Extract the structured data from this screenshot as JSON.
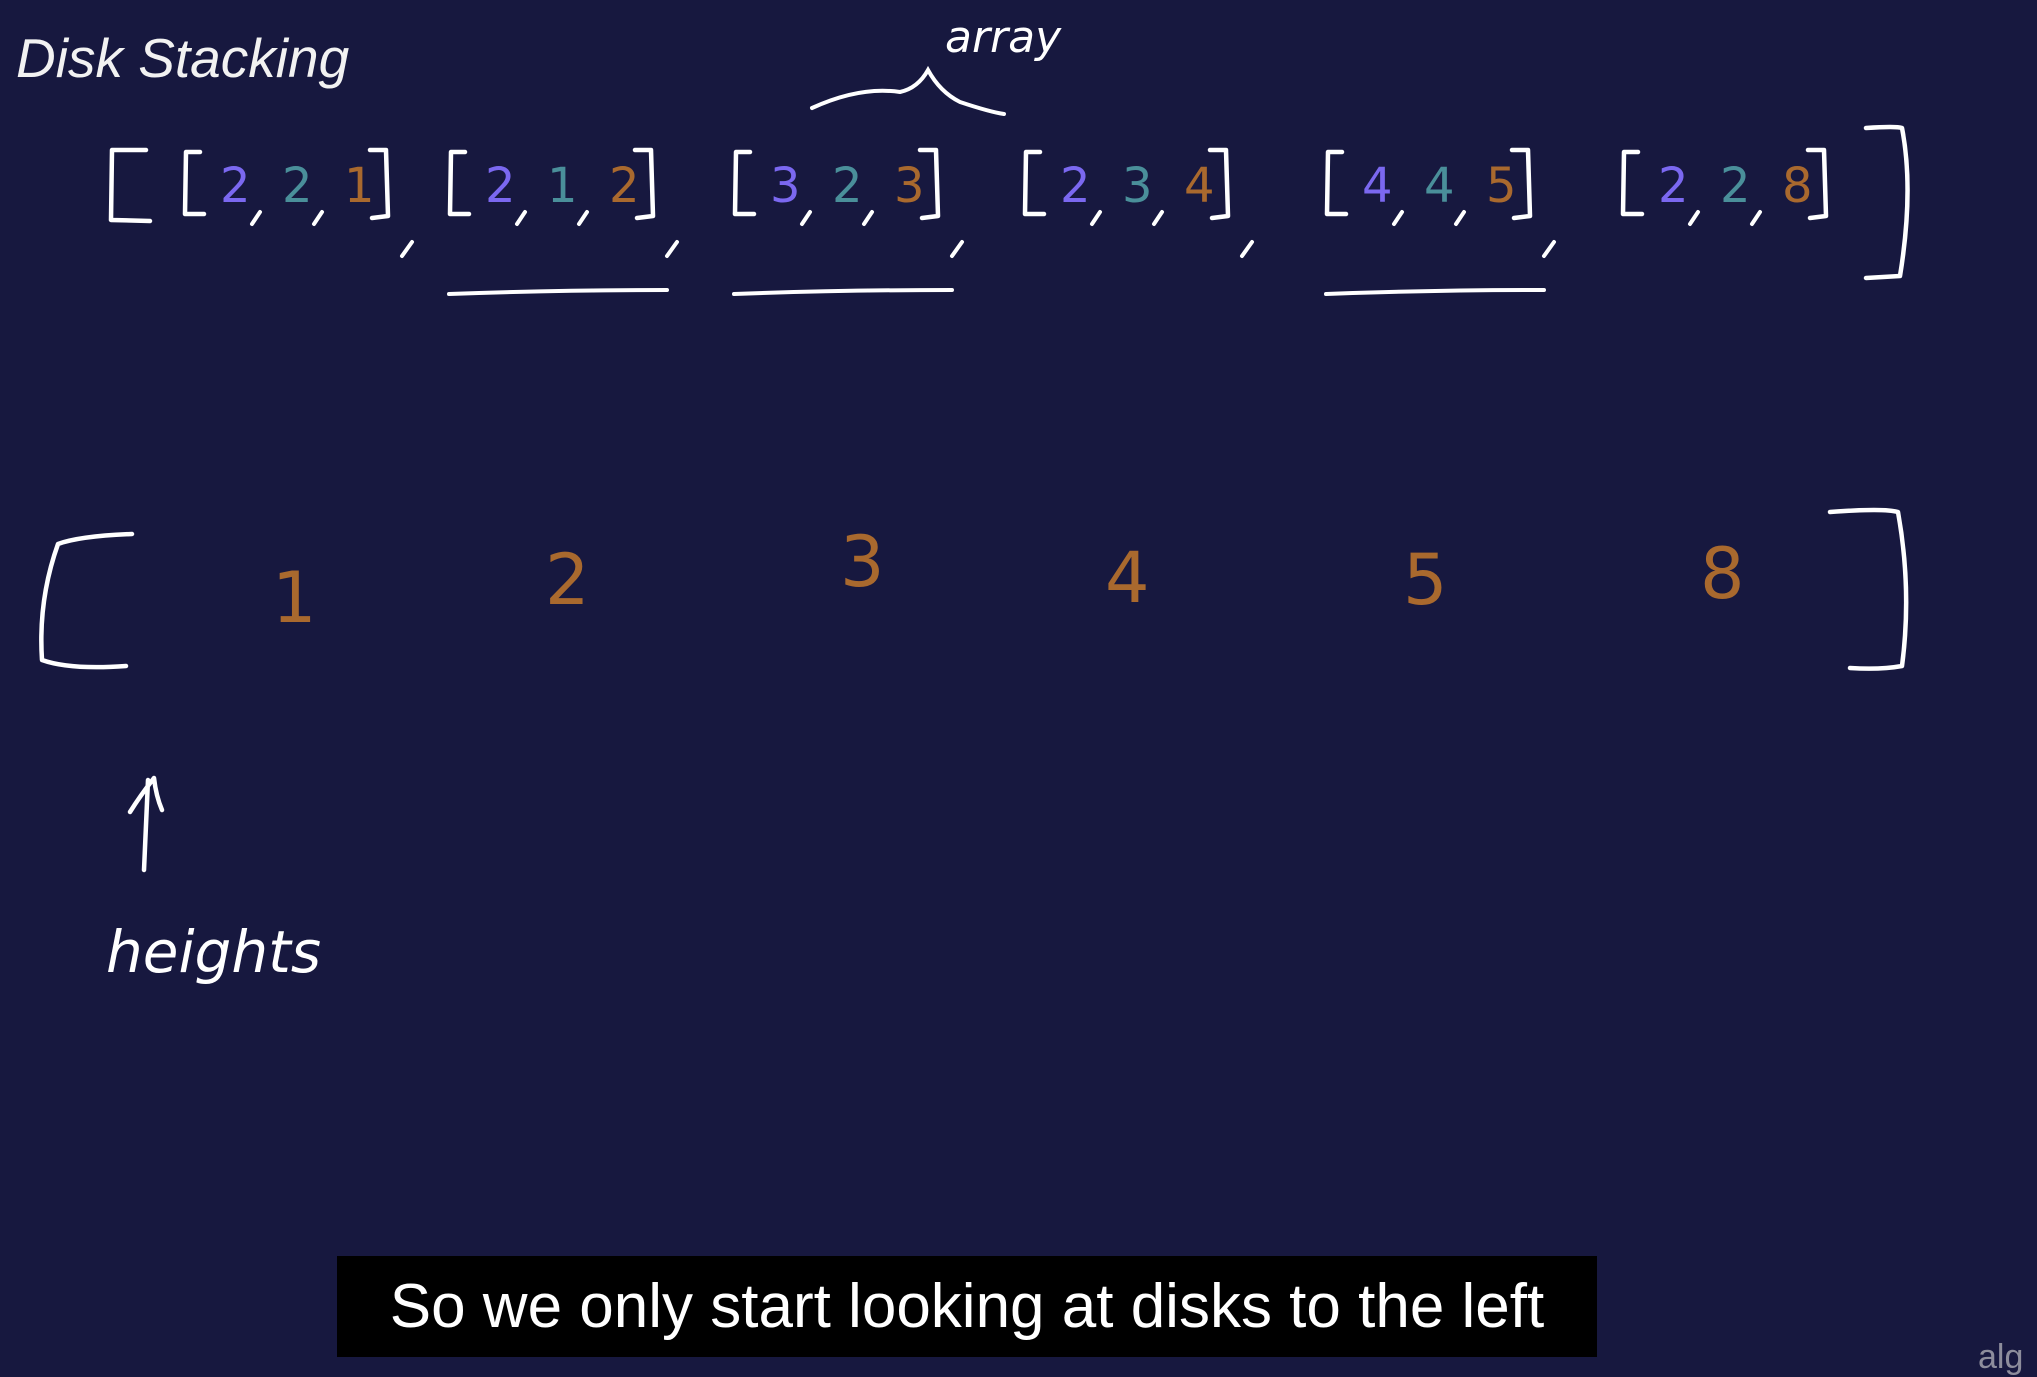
{
  "title": "Disk Stacking",
  "annotation_top": "array",
  "annotation_bottom": "heights",
  "disks": [
    [
      "2",
      "2",
      "1"
    ],
    [
      "2",
      "1",
      "2"
    ],
    [
      "3",
      "2",
      "3"
    ],
    [
      "2",
      "3",
      "4"
    ],
    [
      "4",
      "4",
      "5"
    ],
    [
      "2",
      "2",
      "8"
    ]
  ],
  "underlined_disk_indices": [
    1,
    2,
    4
  ],
  "heights": [
    "1",
    "2",
    "3",
    "4",
    "5",
    "8"
  ],
  "caption": "So we only start looking at disks to the left",
  "watermark": "alg",
  "colors": {
    "background": "#17183f",
    "ink": "#ffffff",
    "width": "#7b68f0",
    "depth": "#4a8f9a",
    "height": "#a9692e"
  }
}
